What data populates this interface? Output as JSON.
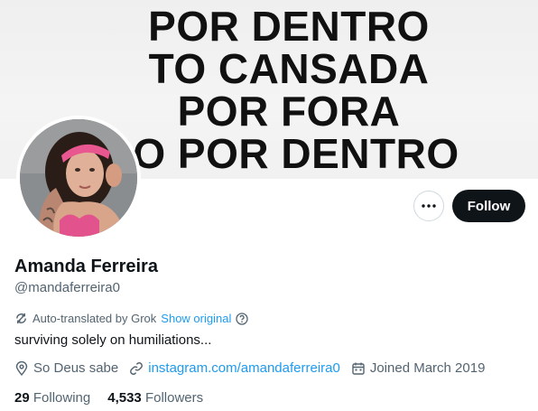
{
  "banner": {
    "lines": [
      "POR DENTRO",
      "TO CANSADA",
      "POR FORA",
      "O POR DENTRO"
    ]
  },
  "actions": {
    "more_icon": "ellipsis-icon",
    "follow_label": "Follow"
  },
  "profile": {
    "name": "Amanda Ferreira",
    "handle": "@mandaferreira0",
    "translation_note": "Auto-translated by Grok",
    "show_original": "Show original",
    "bio": "surviving solely on humiliations..."
  },
  "meta": {
    "location": "So Deus sabe",
    "website": "instagram.com/amandaferreira0",
    "joined": "Joined March 2019"
  },
  "stats": {
    "following_count": "29",
    "following_label": "Following",
    "followers_count": "4,533",
    "followers_label": "Followers"
  },
  "colors": {
    "accent": "#1d9bf0",
    "secondary_text": "#536471",
    "primary_text": "#0f1419",
    "avatar_headband": "#e8578f"
  }
}
